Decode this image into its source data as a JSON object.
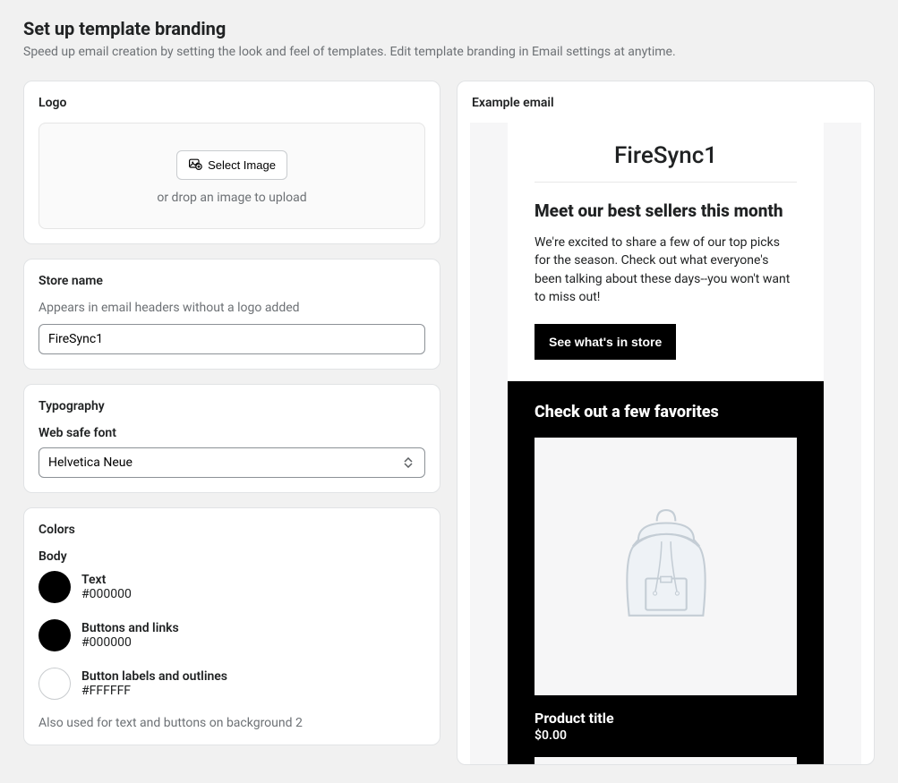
{
  "page": {
    "title": "Set up template branding",
    "subtitle": "Speed up email creation by setting the look and feel of templates. Edit template branding in Email settings at anytime."
  },
  "logo": {
    "title": "Logo",
    "button": "Select Image",
    "drop_text": "or drop an image to upload"
  },
  "store_name": {
    "title": "Store name",
    "helper": "Appears in email headers without a logo added",
    "value": "FireSync1"
  },
  "typography": {
    "title": "Typography",
    "label": "Web safe font",
    "value": "Helvetica Neue"
  },
  "colors": {
    "title": "Colors",
    "body_label": "Body",
    "items": [
      {
        "label": "Text",
        "hex": "#000000"
      },
      {
        "label": "Buttons and links",
        "hex": "#000000"
      },
      {
        "label": "Button labels and outlines",
        "hex": "#FFFFFF"
      }
    ],
    "note": "Also used for text and buttons on background 2"
  },
  "preview": {
    "title": "Example email",
    "brand": "FireSync1",
    "heading": "Meet our best sellers this month",
    "body": "We're excited to share a few of our top picks for the season. Check out what everyone's been talking about these days--you won't want to miss out!",
    "cta": "See what's in store",
    "favorites_heading": "Check out a few favorites",
    "product_title": "Product title",
    "product_price": "$0.00"
  }
}
